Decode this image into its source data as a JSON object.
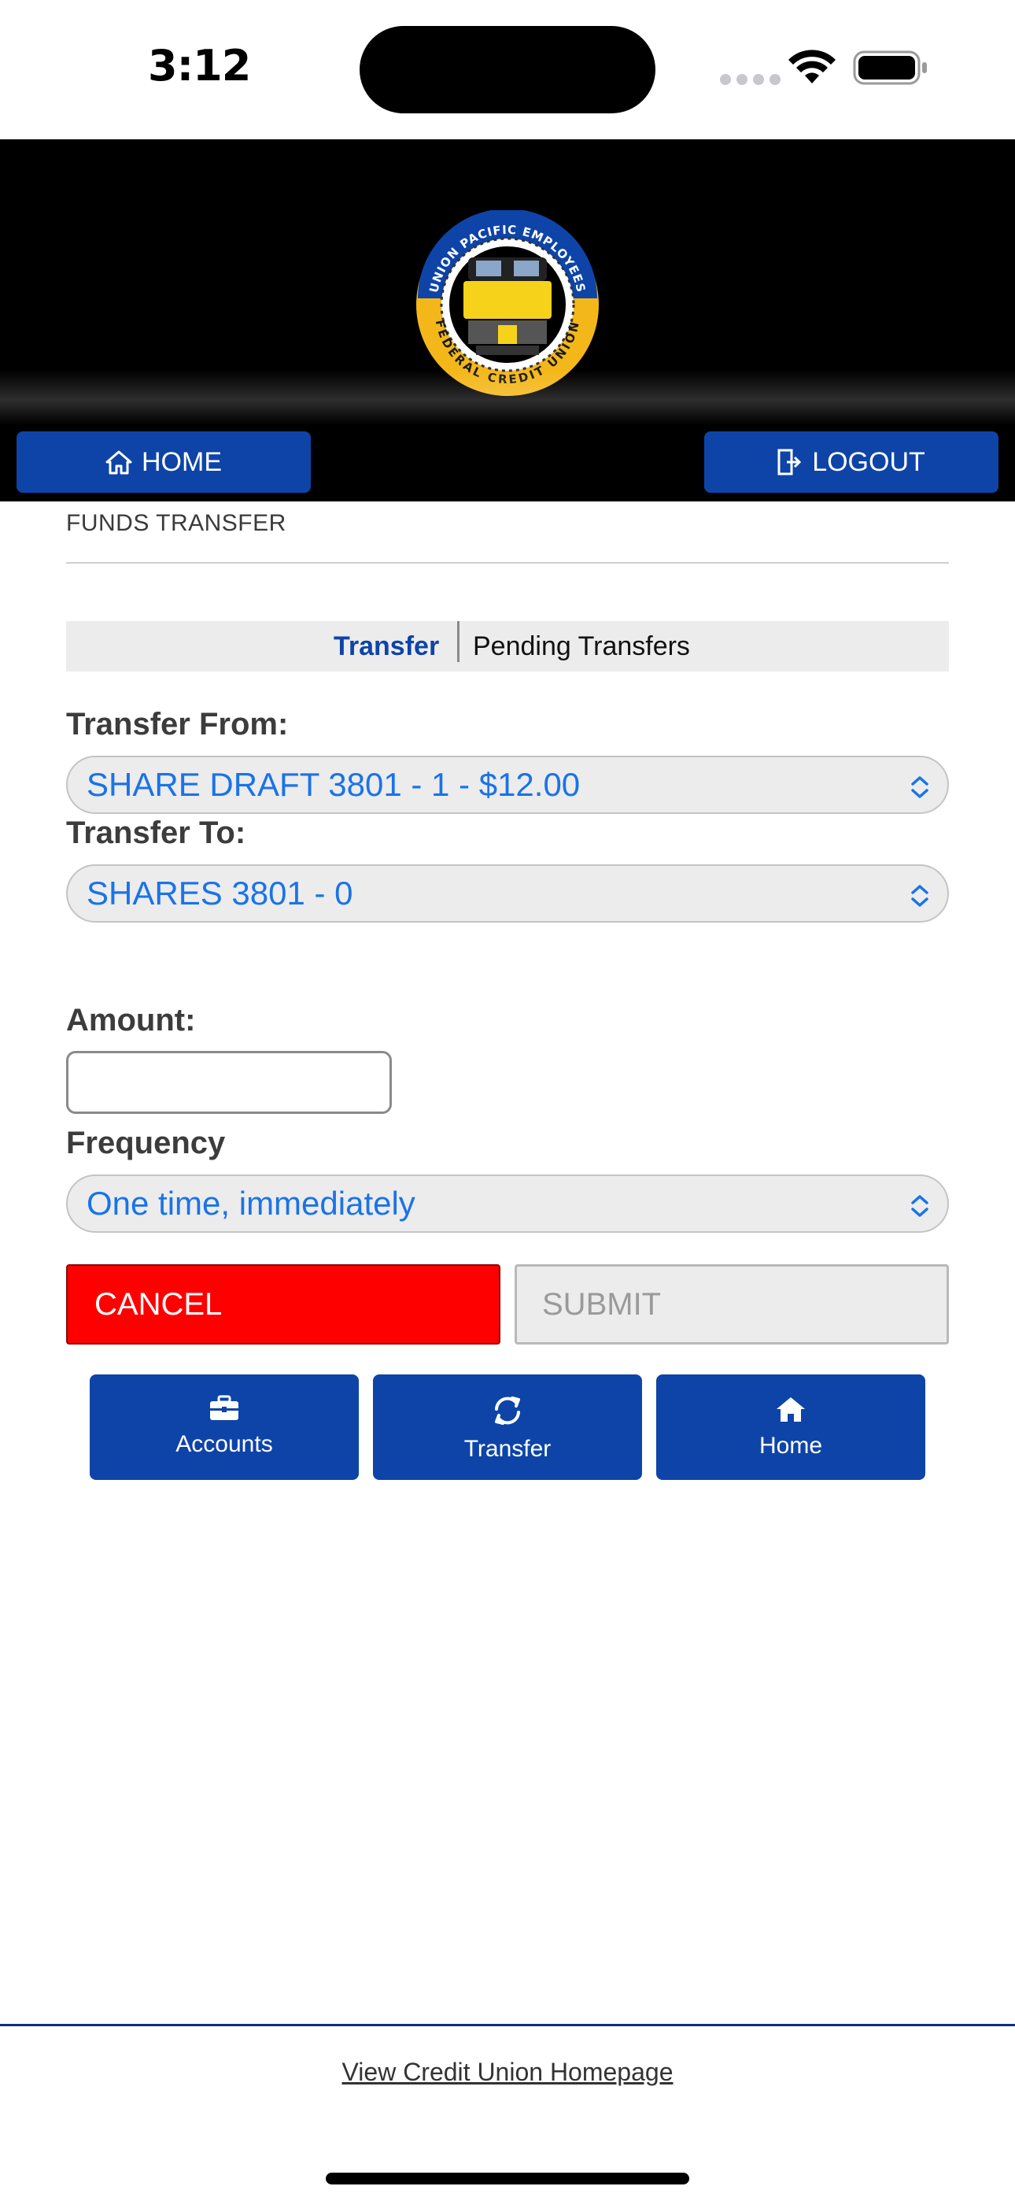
{
  "status_bar": {
    "time": "3:12"
  },
  "header": {
    "logo": {
      "top_text": "UNION PACIFIC EMPLOYEES",
      "bottom_text": "FEDERAL CREDIT UNION"
    },
    "home_button": "HOME",
    "logout_button": "LOGOUT",
    "accent_color": "#0e44a8"
  },
  "page": {
    "title": "FUNDS TRANSFER",
    "tabs": [
      {
        "label": "Transfer",
        "active": true
      },
      {
        "label": "Pending Transfers",
        "active": false
      }
    ]
  },
  "form": {
    "transfer_from": {
      "label": "Transfer From:",
      "value": "SHARE DRAFT 3801 - 1 - $12.00"
    },
    "transfer_to": {
      "label": "Transfer To:",
      "value": "SHARES 3801 - 0"
    },
    "amount": {
      "label": "Amount:",
      "value": ""
    },
    "frequency": {
      "label": "Frequency",
      "value": "One time, immediately"
    },
    "cancel_button": "CANCEL",
    "submit_button": "SUBMIT",
    "cancel_color": "#ff0000"
  },
  "quick_nav": [
    {
      "label": "Accounts",
      "icon": "briefcase-icon"
    },
    {
      "label": "Transfer",
      "icon": "refresh-icon"
    },
    {
      "label": "Home",
      "icon": "home-icon"
    }
  ],
  "footer": {
    "link": "View Credit Union Homepage"
  }
}
